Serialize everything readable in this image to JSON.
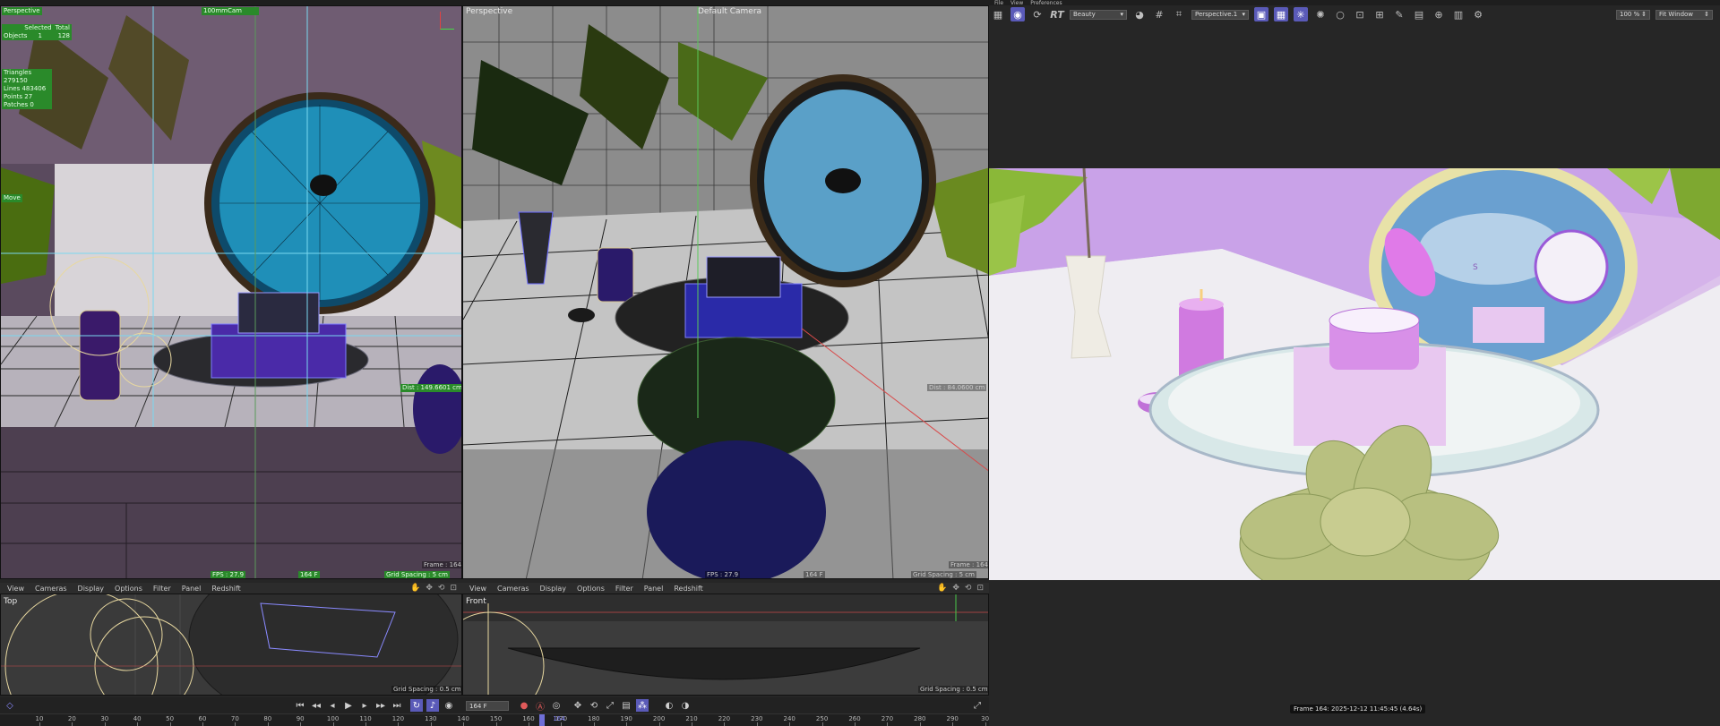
{
  "viewports": {
    "top_left": {
      "label": "Perspective",
      "camera_label": "100mmCam",
      "stats": {
        "header_selected": "Selected",
        "header_total": "Total",
        "objects_label": "Objects",
        "objects_selected": "1",
        "objects_total": "128",
        "triangles": "Triangles 279150",
        "lines": "Lines      483406",
        "points": "Points     27",
        "patches": "Patches    0"
      },
      "move_label": "Move",
      "dist_label": "Dist : 149.6601 cm",
      "fps": "FPS : 27.9",
      "frame_field": "164 F",
      "grid_spacing": "Grid Spacing : 5 cm",
      "frame_badge": "Frame : 164"
    },
    "top_right": {
      "label": "Perspective",
      "camera_label": "Default Camera",
      "dist_label": "Dist : 84.0600 cm",
      "fps": "FPS : 27.9",
      "frame_field": "164 F",
      "grid_spacing": "Grid Spacing : 5 cm",
      "frame_badge": "Frame : 164"
    },
    "bottom_left": {
      "label": "Top",
      "grid_spacing": "Grid Spacing : 0.5 cm"
    },
    "bottom_right": {
      "label": "Front",
      "grid_spacing": "Grid Spacing : 0.5 cm"
    }
  },
  "menus": {
    "bottom_left": [
      "View",
      "Cameras",
      "Display",
      "Options",
      "Filter",
      "Panel",
      "Redshift"
    ],
    "bottom_right": [
      "View",
      "Cameras",
      "Display",
      "Options",
      "Filter",
      "Panel",
      "Redshift"
    ]
  },
  "render_view": {
    "top_menu": [
      "File",
      "View",
      "Preferences"
    ],
    "rt_label": "RT",
    "aov_select": "Beauty",
    "camera_select": "Perspective.1",
    "zoom": "100 %",
    "fit_select": "Fit Window",
    "status": "Frame  164:  2025-12-12  11:45:45  (4.64s)",
    "jar_label": "S"
  },
  "timeline": {
    "frame_input": "164 F",
    "ticks": [
      "10",
      "20",
      "30",
      "40",
      "50",
      "60",
      "70",
      "80",
      "90",
      "100",
      "110",
      "120",
      "130",
      "140",
      "150",
      "160",
      "170",
      "180",
      "190",
      "200",
      "210",
      "220",
      "230",
      "240",
      "250",
      "260",
      "270",
      "280",
      "290",
      "30"
    ],
    "current_frame": "164"
  },
  "colors": {
    "accent": "#5a5ab8",
    "hud_green": "#2a8a2a",
    "render_bg_wall": "#c9a2e8",
    "render_table": "#e8e6ea"
  }
}
